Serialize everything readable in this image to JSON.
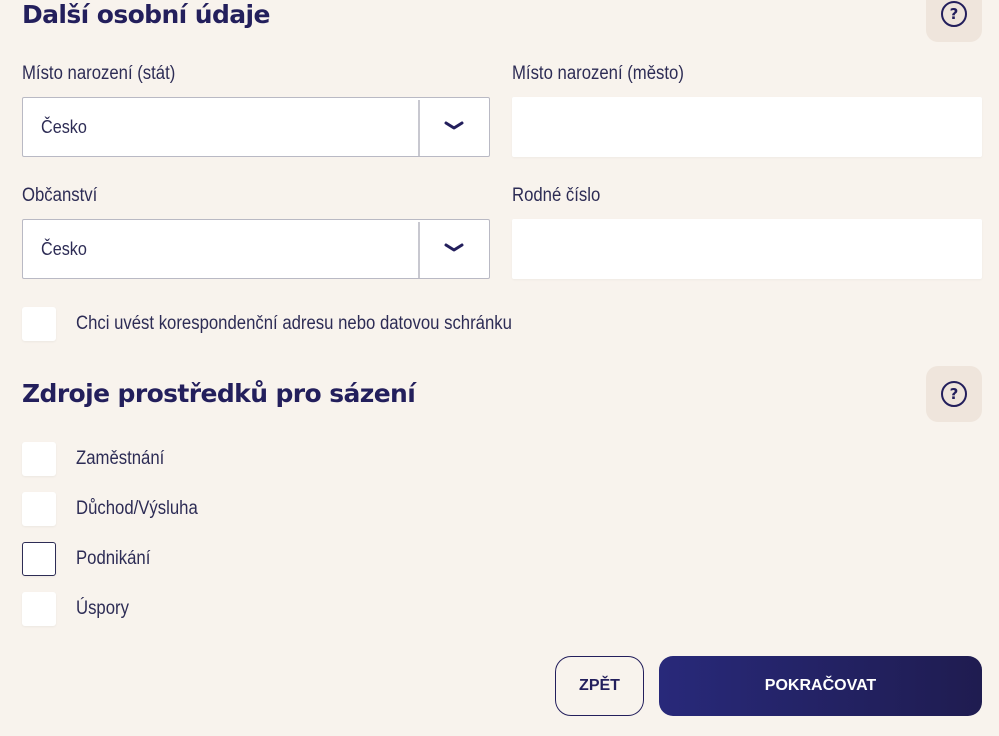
{
  "personal": {
    "title": "Další osobní údaje",
    "birth_country_label": "Místo narození (stát)",
    "birth_country_value": "Česko",
    "birth_city_label": "Místo narození (město)",
    "birth_city_value": "",
    "citizenship_label": "Občanství",
    "citizenship_value": "Česko",
    "birth_number_label": "Rodné číslo",
    "birth_number_value": "",
    "correspondence_label": "Chci uvést korespondenční adresu nebo datovou schránku"
  },
  "funds": {
    "title": "Zdroje prostředků pro sázení",
    "options": [
      {
        "label": "Zaměstnání",
        "checked": false
      },
      {
        "label": "Důchod/Výsluha",
        "checked": false
      },
      {
        "label": "Podnikání",
        "checked": false
      },
      {
        "label": "Úspory",
        "checked": false
      }
    ]
  },
  "help": {
    "glyph": "?"
  },
  "actions": {
    "back_label": "ZPĚT",
    "next_label": "POKRAČOVAT"
  },
  "icons": {
    "help": "question-circle-icon",
    "dropdown": "chevron-down-icon"
  },
  "colors": {
    "background": "#f8f3ed",
    "primary": "#231f5c",
    "help_bg": "#efe5dc"
  }
}
